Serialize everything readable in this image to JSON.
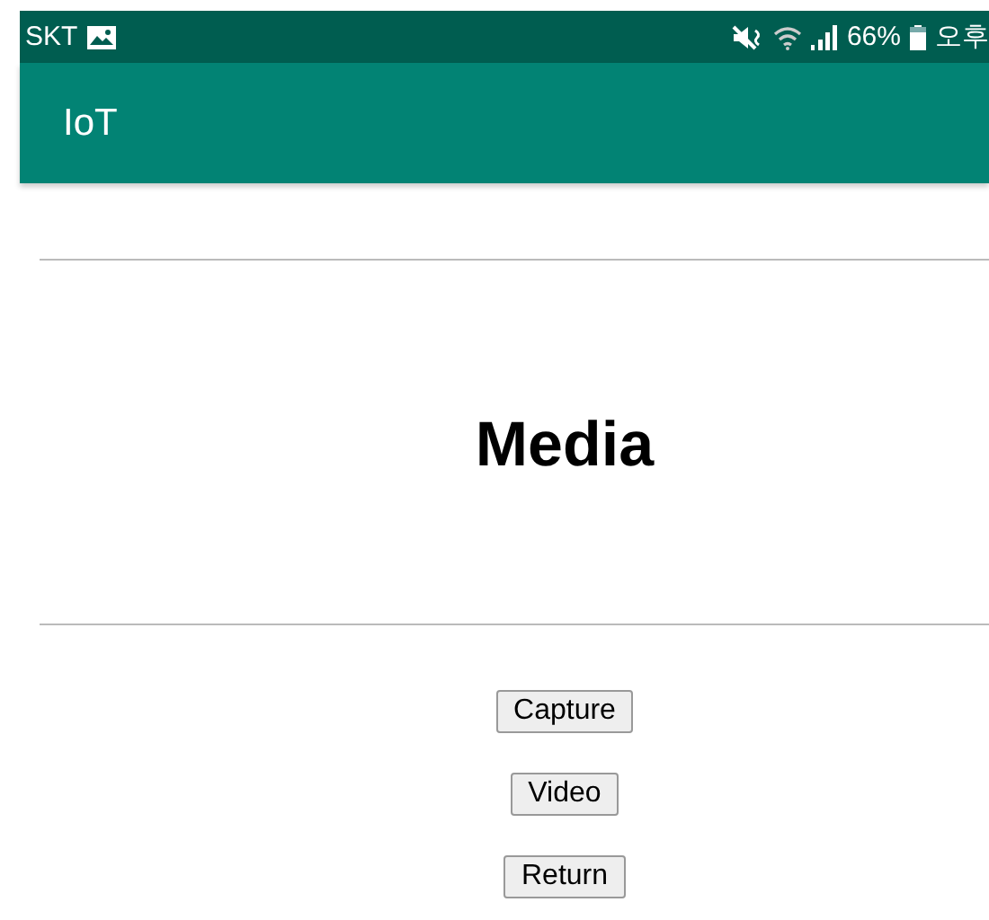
{
  "status_bar": {
    "carrier": "SKT",
    "battery": "66%",
    "time": "오후"
  },
  "app_bar": {
    "title": "IoT"
  },
  "heading": "Media",
  "buttons": [
    {
      "label": "Capture"
    },
    {
      "label": "Video"
    },
    {
      "label": "Return"
    }
  ]
}
